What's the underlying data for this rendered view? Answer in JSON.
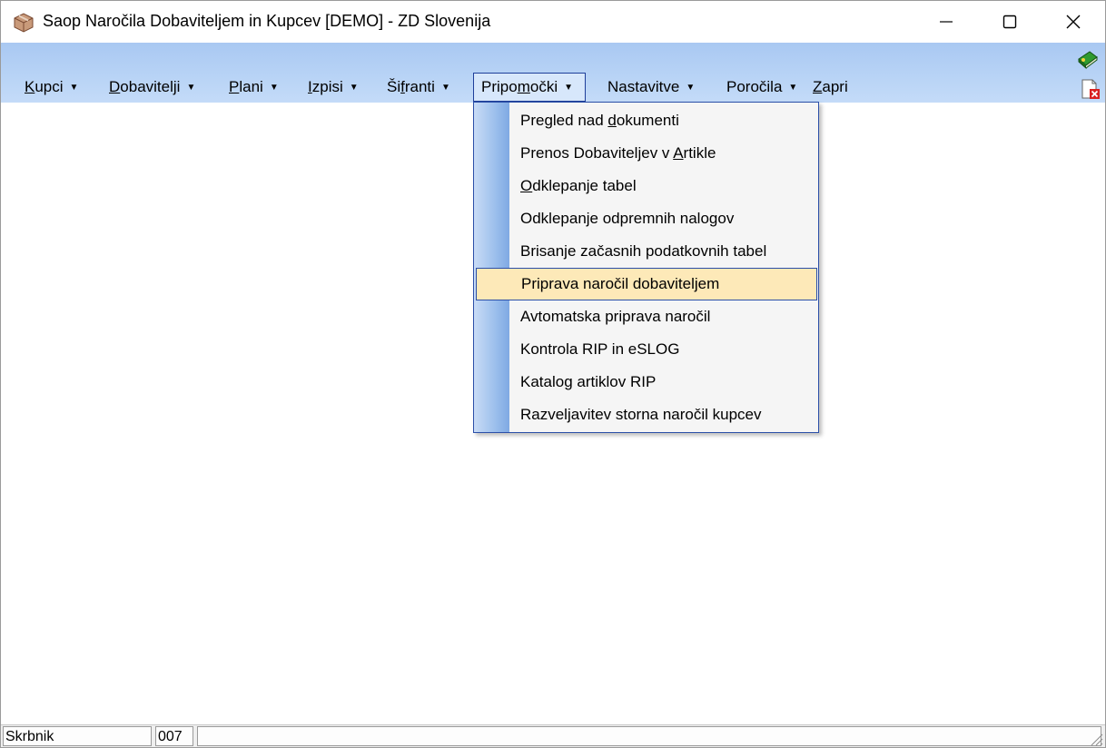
{
  "window": {
    "title": "Saop Naročila Dobaviteljem in Kupcev [DEMO] - ZD Slovenija"
  },
  "menubar": {
    "items": [
      {
        "pre": "",
        "u": "K",
        "post": "upci",
        "arrow": "▼"
      },
      {
        "pre": "",
        "u": "D",
        "post": "obavitelji",
        "arrow": "▼"
      },
      {
        "pre": "",
        "u": "P",
        "post": "lani",
        "arrow": "▼"
      },
      {
        "pre": "",
        "u": "I",
        "post": "zpisi",
        "arrow": "▼"
      },
      {
        "pre": "Ši",
        "u": "f",
        "post": "ranti",
        "arrow": "▼"
      },
      {
        "pre": "Pripo",
        "u": "m",
        "post": "očki",
        "arrow": "▼"
      },
      {
        "pre": "Nastavitve",
        "u": "",
        "post": "",
        "arrow": "▼"
      },
      {
        "pre": "Poročila",
        "u": "",
        "post": "",
        "arrow": "▼"
      },
      {
        "pre": "",
        "u": "Z",
        "post": "apri",
        "arrow": ""
      }
    ],
    "active_index": 5
  },
  "dropdown": {
    "items": [
      {
        "pre": "Pregled nad ",
        "u": "d",
        "post": "okumenti"
      },
      {
        "pre": "Prenos Dobaviteljev v ",
        "u": "A",
        "post": "rtikle"
      },
      {
        "pre": "",
        "u": "O",
        "post": "dklepanje tabel"
      },
      {
        "pre": "Odklepanje odpremnih nalogov",
        "u": "",
        "post": ""
      },
      {
        "pre": "Brisanje začasnih podatkovnih tabel",
        "u": "",
        "post": ""
      },
      {
        "pre": "Priprava naročil dobaviteljem",
        "u": "",
        "post": ""
      },
      {
        "pre": "Avtomatska priprava naročil",
        "u": "",
        "post": ""
      },
      {
        "pre": "Kontrola RIP in eSLOG",
        "u": "",
        "post": ""
      },
      {
        "pre": "Katalog artiklov RIP",
        "u": "",
        "post": ""
      },
      {
        "pre": "Razveljavitev storna naročil kupcev",
        "u": "",
        "post": ""
      }
    ],
    "highlighted_index": 5
  },
  "statusbar": {
    "user": "Skrbnik",
    "code": "007",
    "message": ""
  },
  "icons": {
    "app": "app-box-icon",
    "toolbar_top": "green-book-icon",
    "toolbar_bottom": "close-document-icon"
  },
  "colors": {
    "menubar": "#b9d4f6",
    "highlight": "#fde9b8",
    "border": "#2b4fa8"
  }
}
